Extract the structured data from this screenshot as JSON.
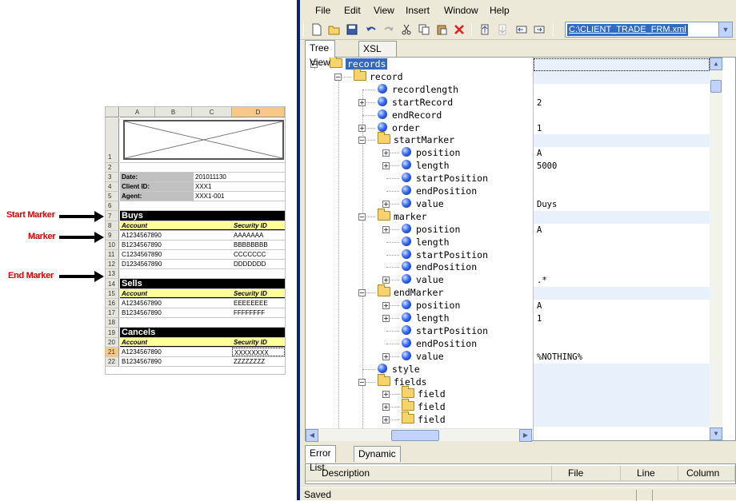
{
  "markers": [
    {
      "label": "Start Marker"
    },
    {
      "label": "Marker"
    },
    {
      "label": "End Marker"
    }
  ],
  "sheet": {
    "columns": [
      "A",
      "B",
      "C",
      "D"
    ],
    "rows": [
      {
        "n": "1"
      },
      {
        "n": "2"
      },
      {
        "n": "3",
        "label": "Date:",
        "value": "201011130"
      },
      {
        "n": "4",
        "label": "Client ID:",
        "value": "XXX1"
      },
      {
        "n": "5",
        "label": "Agent:",
        "value": "XXX1-001"
      },
      {
        "n": "6"
      },
      {
        "n": "7",
        "header": "Buys"
      },
      {
        "n": "8",
        "sub": [
          "Account",
          "Security ID"
        ]
      },
      {
        "n": "9",
        "a": "A1234567890",
        "d": "AAAAAAA"
      },
      {
        "n": "10",
        "a": "B1234567890",
        "d": "BBBBBBBB"
      },
      {
        "n": "11",
        "a": "C1234567890",
        "d": "CCCCCCC"
      },
      {
        "n": "12",
        "a": "D1234567890",
        "d": "DDDDDDD"
      },
      {
        "n": "13"
      },
      {
        "n": "14",
        "header": "Sells"
      },
      {
        "n": "15",
        "sub": [
          "Account",
          "Security ID"
        ]
      },
      {
        "n": "16",
        "a": "A1234567890",
        "d": "EEEEEEEE"
      },
      {
        "n": "17",
        "a": "B1234567890",
        "d": "FFFFFFFF"
      },
      {
        "n": "18"
      },
      {
        "n": "19",
        "header": "Cancels"
      },
      {
        "n": "20",
        "sub": [
          "Account",
          "Security ID"
        ]
      },
      {
        "n": "21",
        "a": "A1234567890",
        "d": "XXXXXXXX"
      },
      {
        "n": "22",
        "a": "B1234567890",
        "d": "ZZZZZZZZ"
      }
    ]
  },
  "menu": {
    "file": "File",
    "edit": "Edit",
    "view": "View",
    "insert": "Insert",
    "window": "Window",
    "help": "Help"
  },
  "toolbar": {
    "file_path": "C:\\CLIENT_TRADE_FRM.xml"
  },
  "tabs_top": [
    "Tree View",
    "XSL Output"
  ],
  "tree": [
    {
      "label": "records",
      "type": "folder",
      "expander": "-",
      "value": "",
      "selected": true
    },
    {
      "label": "record",
      "type": "folder",
      "expander": "-",
      "value": ""
    },
    {
      "label": "recordlength",
      "type": "leaf",
      "expander": "",
      "value": ""
    },
    {
      "label": "startRecord",
      "type": "leaf",
      "expander": "+",
      "value": "2"
    },
    {
      "label": "endRecord",
      "type": "leaf",
      "expander": "",
      "value": ""
    },
    {
      "label": "order",
      "type": "leaf",
      "expander": "+",
      "value": "1"
    },
    {
      "label": "startMarker",
      "type": "folder",
      "expander": "-",
      "value": ""
    },
    {
      "label": "position",
      "type": "leaf",
      "expander": "+",
      "value": "A"
    },
    {
      "label": "length",
      "type": "leaf",
      "expander": "+",
      "value": "5000"
    },
    {
      "label": "startPosition",
      "type": "leaf",
      "expander": "",
      "value": ""
    },
    {
      "label": "endPosition",
      "type": "leaf",
      "expander": "",
      "value": ""
    },
    {
      "label": "value",
      "type": "leaf",
      "expander": "+",
      "value": "Duys"
    },
    {
      "label": "marker",
      "type": "folder",
      "expander": "-",
      "value": ""
    },
    {
      "label": "position",
      "type": "leaf",
      "expander": "+",
      "value": "A"
    },
    {
      "label": "length",
      "type": "leaf",
      "expander": "",
      "value": ""
    },
    {
      "label": "startPosition",
      "type": "leaf",
      "expander": "",
      "value": ""
    },
    {
      "label": "endPosition",
      "type": "leaf",
      "expander": "",
      "value": ""
    },
    {
      "label": "value",
      "type": "leaf",
      "expander": "+",
      "value": ".*"
    },
    {
      "label": "endMarker",
      "type": "folder",
      "expander": "-",
      "value": ""
    },
    {
      "label": "position",
      "type": "leaf",
      "expander": "+",
      "value": "A"
    },
    {
      "label": "length",
      "type": "leaf",
      "expander": "+",
      "value": "1"
    },
    {
      "label": "startPosition",
      "type": "leaf",
      "expander": "",
      "value": ""
    },
    {
      "label": "endPosition",
      "type": "leaf",
      "expander": "",
      "value": ""
    },
    {
      "label": "value",
      "type": "leaf",
      "expander": "+",
      "value": "%NOTHING%"
    },
    {
      "label": "style",
      "type": "leaf",
      "expander": "",
      "value": ""
    },
    {
      "label": "fields",
      "type": "folder",
      "expander": "-",
      "value": ""
    },
    {
      "label": "field",
      "type": "folder",
      "expander": "+",
      "value": ""
    },
    {
      "label": "field",
      "type": "folder",
      "expander": "+",
      "value": ""
    },
    {
      "label": "field",
      "type": "folder",
      "expander": "+",
      "value": ""
    }
  ],
  "tabs_bottom": [
    "Error List",
    "Dynamic Help"
  ],
  "error_columns": [
    "Description",
    "File",
    "Line",
    "Column"
  ],
  "status": "Saved",
  "colors": {
    "accent": "#316ac5",
    "marker_red": "#e00000"
  }
}
